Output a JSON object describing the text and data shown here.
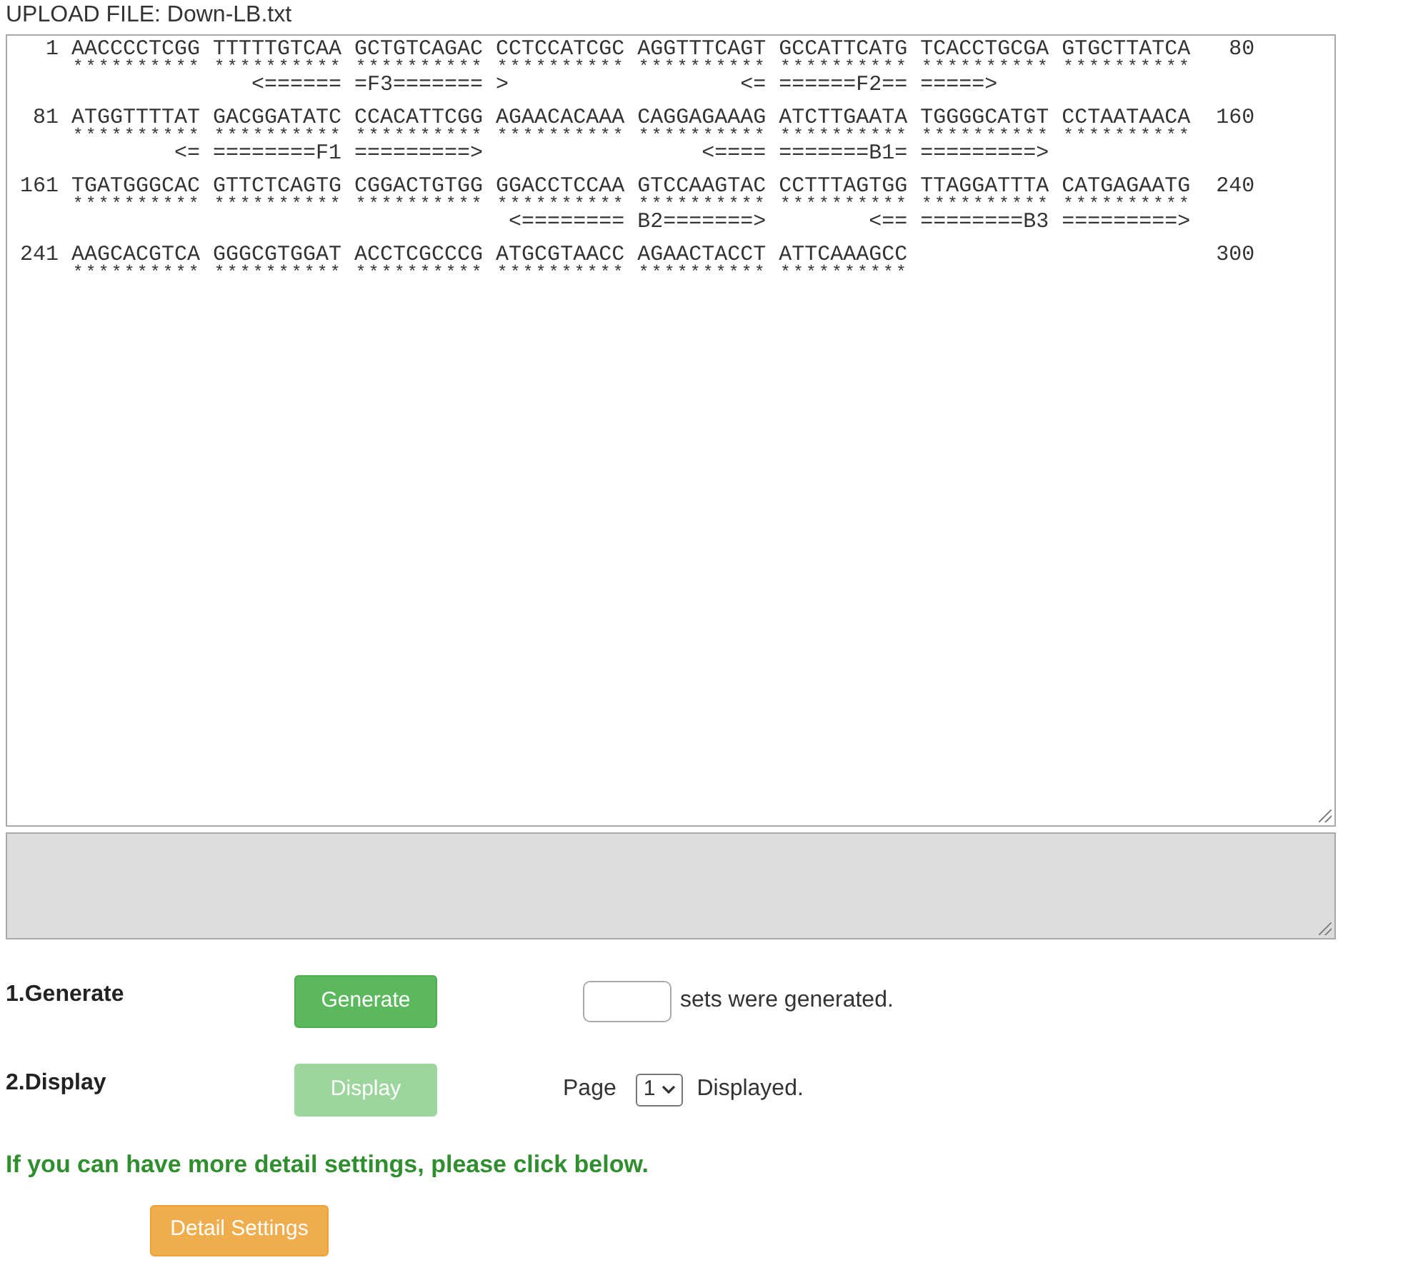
{
  "upload_file": {
    "label": "UPLOAD FILE: Down-LB.txt"
  },
  "sequence_view": {
    "rows": [
      {
        "start": "1",
        "blocks": [
          "AACCCCTCGG",
          "TTTTTGTCAA",
          "GCTGTCAGAC",
          "CCTCCATCGC",
          "AGGTTTCAGT",
          "GCCATTCATG",
          "TCACCTGCGA",
          "GTGCTTATCA"
        ],
        "end": "80",
        "marks": [
          "**********",
          "**********",
          "**********",
          "**********",
          "**********",
          "**********",
          "**********",
          "**********"
        ],
        "annotation": "                   <====== =F3======= >                  <= ======F2== =====>"
      },
      {
        "start": "81",
        "blocks": [
          "ATGGTTTTAT",
          "GACGGATATC",
          "CCACATTCGG",
          "AGAACACAAA",
          "CAGGAGAAAG",
          "ATCTTGAATA",
          "TGGGGCATGT",
          "CCTAATAACA"
        ],
        "end": "160",
        "marks": [
          "**********",
          "**********",
          "**********",
          "**********",
          "**********",
          "**********",
          "**********",
          "**********"
        ],
        "annotation": "             <= ========F1 =========>                 <==== =======B1= =========>"
      },
      {
        "start": "161",
        "blocks": [
          "TGATGGGCAC",
          "GTTCTCAGTG",
          "CGGACTGTGG",
          "GGACCTCCAA",
          "GTCCAAGTAC",
          "CCTTTAGTGG",
          "TTAGGATTTA",
          "CATGAGAATG"
        ],
        "end": "240",
        "marks": [
          "**********",
          "**********",
          "**********",
          "**********",
          "**********",
          "**********",
          "**********",
          "**********"
        ],
        "annotation": "                                       <======== B2=======>        <== ========B3 =========>"
      },
      {
        "start": "241",
        "blocks": [
          "AAGCACGTCA",
          "GGGCGTGGAT",
          "ACCTCGCCCG",
          "ATGCGTAACC",
          "AGAACTACCT",
          "ATTCAAAGCC"
        ],
        "end": "300",
        "marks": [
          "**********",
          "**********",
          "**********",
          "**********",
          "**********",
          "**********"
        ]
      }
    ]
  },
  "output_box": {
    "disabled": true
  },
  "steps": [
    {
      "kind": "generate",
      "label": "1.Generate",
      "button": {
        "label": "Generate",
        "disabled": false
      },
      "suffix": "sets were generated."
    },
    {
      "kind": "display",
      "label": "2.Display",
      "button": {
        "label": "Display",
        "disabled": true
      },
      "prefix": "Page",
      "page": "1",
      "suffix": "Displayed."
    }
  ],
  "hint": "If you can have more detail settings, please click below.",
  "detail_button": {
    "label": "Detail Settings"
  }
}
